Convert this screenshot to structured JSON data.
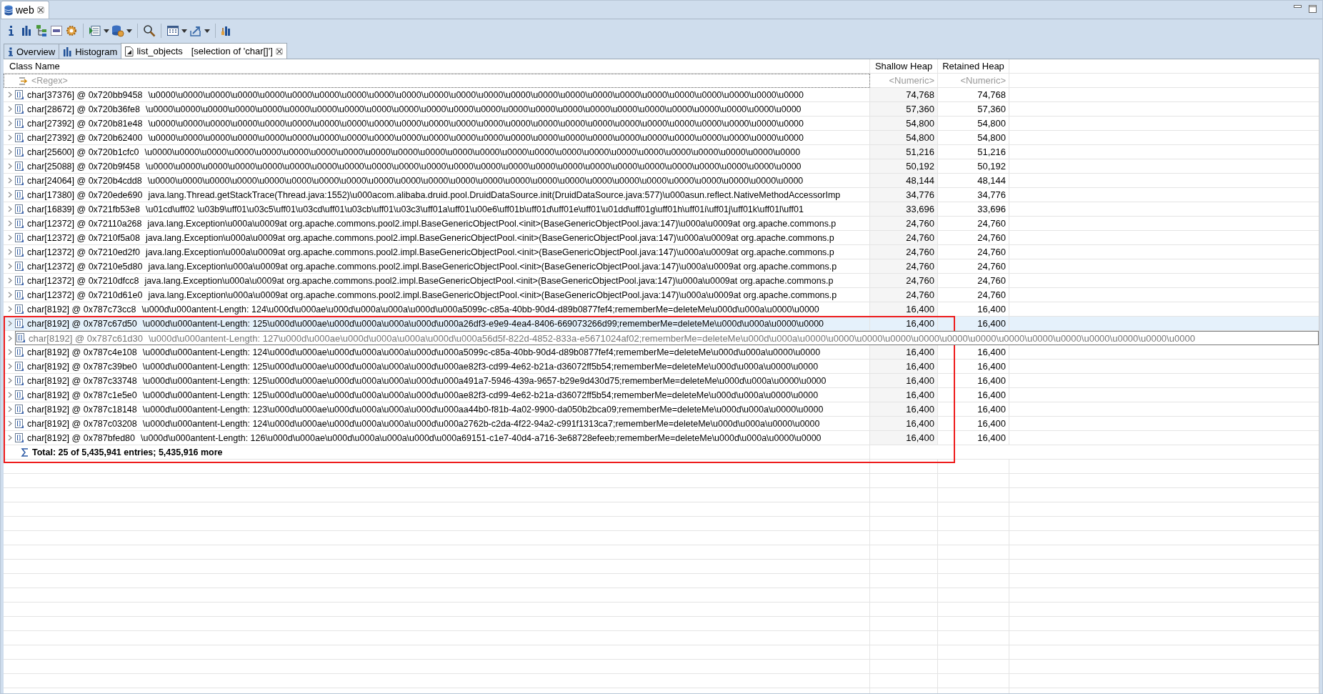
{
  "window": {
    "title": "web"
  },
  "tabs": [
    {
      "kind": "overview",
      "label": "Overview",
      "selected": false
    },
    {
      "kind": "histogram",
      "label": "Histogram",
      "selected": false
    },
    {
      "kind": "list",
      "label": "list_objects",
      "detail": "[selection of 'char[]']",
      "selected": true
    }
  ],
  "table": {
    "columns": [
      {
        "title": "Class Name",
        "filter": "<Regex>"
      },
      {
        "title": "Shallow Heap",
        "filter": "<Numeric>"
      },
      {
        "title": "Retained Heap",
        "filter": "<Numeric>"
      }
    ],
    "rows": [
      {
        "name": "char[37376] @ 0x720bb9458",
        "value": "\\u0000\\u0000\\u0000\\u0000\\u0000\\u0000\\u0000\\u0000\\u0000\\u0000\\u0000\\u0000\\u0000\\u0000\\u0000\\u0000\\u0000\\u0000\\u0000\\u0000\\u0000\\u0000\\u0000\\u0000",
        "shallow": "74,768",
        "retained": "74,768",
        "selected": false,
        "hovered": false,
        "highlighted": false
      },
      {
        "name": "char[28672] @ 0x720b36fe8",
        "value": "\\u0000\\u0000\\u0000\\u0000\\u0000\\u0000\\u0000\\u0000\\u0000\\u0000\\u0000\\u0000\\u0000\\u0000\\u0000\\u0000\\u0000\\u0000\\u0000\\u0000\\u0000\\u0000\\u0000\\u0000",
        "shallow": "57,360",
        "retained": "57,360",
        "selected": false,
        "hovered": false,
        "highlighted": false
      },
      {
        "name": "char[27392] @ 0x720b81e48",
        "value": "\\u0000\\u0000\\u0000\\u0000\\u0000\\u0000\\u0000\\u0000\\u0000\\u0000\\u0000\\u0000\\u0000\\u0000\\u0000\\u0000\\u0000\\u0000\\u0000\\u0000\\u0000\\u0000\\u0000\\u0000",
        "shallow": "54,800",
        "retained": "54,800",
        "selected": false,
        "hovered": false,
        "highlighted": false
      },
      {
        "name": "char[27392] @ 0x720b62400",
        "value": "\\u0000\\u0000\\u0000\\u0000\\u0000\\u0000\\u0000\\u0000\\u0000\\u0000\\u0000\\u0000\\u0000\\u0000\\u0000\\u0000\\u0000\\u0000\\u0000\\u0000\\u0000\\u0000\\u0000\\u0000",
        "shallow": "54,800",
        "retained": "54,800",
        "selected": false,
        "hovered": false,
        "highlighted": false
      },
      {
        "name": "char[25600] @ 0x720b1cfc0",
        "value": "\\u0000\\u0000\\u0000\\u0000\\u0000\\u0000\\u0000\\u0000\\u0000\\u0000\\u0000\\u0000\\u0000\\u0000\\u0000\\u0000\\u0000\\u0000\\u0000\\u0000\\u0000\\u0000\\u0000\\u0000",
        "shallow": "51,216",
        "retained": "51,216",
        "selected": false,
        "hovered": false,
        "highlighted": false
      },
      {
        "name": "char[25088] @ 0x720b9f458",
        "value": "\\u0000\\u0000\\u0000\\u0000\\u0000\\u0000\\u0000\\u0000\\u0000\\u0000\\u0000\\u0000\\u0000\\u0000\\u0000\\u0000\\u0000\\u0000\\u0000\\u0000\\u0000\\u0000\\u0000\\u0000",
        "shallow": "50,192",
        "retained": "50,192",
        "selected": false,
        "hovered": false,
        "highlighted": false
      },
      {
        "name": "char[24064] @ 0x720b4cdd8",
        "value": "\\u0000\\u0000\\u0000\\u0000\\u0000\\u0000\\u0000\\u0000\\u0000\\u0000\\u0000\\u0000\\u0000\\u0000\\u0000\\u0000\\u0000\\u0000\\u0000\\u0000\\u0000\\u0000\\u0000\\u0000",
        "shallow": "48,144",
        "retained": "48,144",
        "selected": false,
        "hovered": false,
        "highlighted": false
      },
      {
        "name": "char[17380] @ 0x720ede690",
        "value": "java.lang.Thread.getStackTrace(Thread.java:1552)\\u000acom.alibaba.druid.pool.DruidDataSource.init(DruidDataSource.java:577)\\u000asun.reflect.NativeMethodAccessorImp",
        "shallow": "34,776",
        "retained": "34,776",
        "selected": false,
        "hovered": false,
        "highlighted": false
      },
      {
        "name": "char[16839] @ 0x721fb53e8",
        "value": "\\u01cd\\uff02 \\u03b9\\uff01\\u03c5\\uff01\\u03cd\\uff01\\u03cb\\uff01\\u03c3\\uff01a\\uff01\\u00e6\\uff01b\\uff01d\\uff01e\\uff01\\u01dd\\uff01g\\uff01h\\uff01i\\uff01j\\uff01k\\uff01l\\uff01",
        "shallow": "33,696",
        "retained": "33,696",
        "selected": false,
        "hovered": false,
        "highlighted": false
      },
      {
        "name": "char[12372] @ 0x72110a268",
        "value": "java.lang.Exception\\u000a\\u0009at org.apache.commons.pool2.impl.BaseGenericObjectPool.<init>(BaseGenericObjectPool.java:147)\\u000a\\u0009at org.apache.commons.p",
        "shallow": "24,760",
        "retained": "24,760",
        "selected": false,
        "hovered": false,
        "highlighted": false
      },
      {
        "name": "char[12372] @ 0x7210f5a08",
        "value": "java.lang.Exception\\u000a\\u0009at org.apache.commons.pool2.impl.BaseGenericObjectPool.<init>(BaseGenericObjectPool.java:147)\\u000a\\u0009at org.apache.commons.p",
        "shallow": "24,760",
        "retained": "24,760",
        "selected": false,
        "hovered": false,
        "highlighted": false
      },
      {
        "name": "char[12372] @ 0x7210ed2f0",
        "value": "java.lang.Exception\\u000a\\u0009at org.apache.commons.pool2.impl.BaseGenericObjectPool.<init>(BaseGenericObjectPool.java:147)\\u000a\\u0009at org.apache.commons.p",
        "shallow": "24,760",
        "retained": "24,760",
        "selected": false,
        "hovered": false,
        "highlighted": false
      },
      {
        "name": "char[12372] @ 0x7210e5d80",
        "value": "java.lang.Exception\\u000a\\u0009at org.apache.commons.pool2.impl.BaseGenericObjectPool.<init>(BaseGenericObjectPool.java:147)\\u000a\\u0009at org.apache.commons.p",
        "shallow": "24,760",
        "retained": "24,760",
        "selected": false,
        "hovered": false,
        "highlighted": false
      },
      {
        "name": "char[12372] @ 0x7210dfcc8",
        "value": "java.lang.Exception\\u000a\\u0009at org.apache.commons.pool2.impl.BaseGenericObjectPool.<init>(BaseGenericObjectPool.java:147)\\u000a\\u0009at org.apache.commons.p",
        "shallow": "24,760",
        "retained": "24,760",
        "selected": false,
        "hovered": false,
        "highlighted": false
      },
      {
        "name": "char[12372] @ 0x7210d61e0",
        "value": "java.lang.Exception\\u000a\\u0009at org.apache.commons.pool2.impl.BaseGenericObjectPool.<init>(BaseGenericObjectPool.java:147)\\u000a\\u0009at org.apache.commons.p",
        "shallow": "24,760",
        "retained": "24,760",
        "selected": false,
        "hovered": false,
        "highlighted": false
      },
      {
        "name": "char[8192] @ 0x787c73cc8",
        "value": "\\u000d\\u000antent-Length: 124\\u000d\\u000ae\\u000d\\u000a\\u000a\\u000d\\u000a5099c-c85a-40bb-90d4-d89b0877fef4;rememberMe=deleteMe\\u000d\\u000a\\u0000\\u0000",
        "shallow": "16,400",
        "retained": "16,400",
        "selected": false,
        "hovered": false,
        "highlighted": false
      },
      {
        "name": "char[8192] @ 0x787c67d50",
        "value": "\\u000d\\u000antent-Length: 125\\u000d\\u000ae\\u000d\\u000a\\u000a\\u000d\\u000a26df3-e9e9-4ea4-8406-669073266d99;rememberMe=deleteMe\\u000d\\u000a\\u0000\\u0000",
        "shallow": "16,400",
        "retained": "16,400",
        "selected": true,
        "hovered": false,
        "highlighted": true
      },
      {
        "name": "char[8192] @ 0x787c61d30",
        "value": "\\u000d\\u000antent-Length: 127\\u000d\\u000ae\\u000d\\u000a\\u000a\\u000d\\u000a56d5f-822d-4852-833a-e5671024af02;rememberMe=deleteMe\\u000d\\u000a\\u0000\\u0000\\u0000\\u0000\\u0000\\u0000\\u0000\\u0000\\u0000\\u0000\\u0000\\u0000\\u0000\\u0000",
        "selected": false,
        "hovered": true,
        "highlighted": true
      },
      {
        "name": "char[8192] @ 0x787c4e108",
        "value": "\\u000d\\u000antent-Length: 124\\u000d\\u000ae\\u000d\\u000a\\u000a\\u000d\\u000a5099c-c85a-40bb-90d4-d89b0877fef4;rememberMe=deleteMe\\u000d\\u000a\\u0000\\u0000",
        "shallow": "16,400",
        "retained": "16,400",
        "selected": false,
        "hovered": false,
        "highlighted": true
      },
      {
        "name": "char[8192] @ 0x787c39be0",
        "value": "\\u000d\\u000antent-Length: 125\\u000d\\u000ae\\u000d\\u000a\\u000a\\u000d\\u000ae82f3-cd99-4e62-b21a-d36072ff5b54;rememberMe=deleteMe\\u000d\\u000a\\u0000\\u0000",
        "shallow": "16,400",
        "retained": "16,400",
        "selected": false,
        "hovered": false,
        "highlighted": true
      },
      {
        "name": "char[8192] @ 0x787c33748",
        "value": "\\u000d\\u000antent-Length: 125\\u000d\\u000ae\\u000d\\u000a\\u000a\\u000d\\u000a491a7-5946-439a-9657-b29e9d430d75;rememberMe=deleteMe\\u000d\\u000a\\u0000\\u0000",
        "shallow": "16,400",
        "retained": "16,400",
        "selected": false,
        "hovered": false,
        "highlighted": true
      },
      {
        "name": "char[8192] @ 0x787c1e5e0",
        "value": "\\u000d\\u000antent-Length: 125\\u000d\\u000ae\\u000d\\u000a\\u000a\\u000d\\u000ae82f3-cd99-4e62-b21a-d36072ff5b54;rememberMe=deleteMe\\u000d\\u000a\\u0000\\u0000",
        "shallow": "16,400",
        "retained": "16,400",
        "selected": false,
        "hovered": false,
        "highlighted": true
      },
      {
        "name": "char[8192] @ 0x787c18148",
        "value": "\\u000d\\u000antent-Length: 123\\u000d\\u000ae\\u000d\\u000a\\u000a\\u000d\\u000aa44b0-f81b-4a02-9900-da050b2bca09;rememberMe=deleteMe\\u000d\\u000a\\u0000\\u0000",
        "shallow": "16,400",
        "retained": "16,400",
        "selected": false,
        "hovered": false,
        "highlighted": true
      },
      {
        "name": "char[8192] @ 0x787c03208",
        "value": "\\u000d\\u000antent-Length: 124\\u000d\\u000ae\\u000d\\u000a\\u000a\\u000d\\u000a2762b-c2da-4f22-94a2-c991f1313ca7;rememberMe=deleteMe\\u000d\\u000a\\u0000\\u0000",
        "shallow": "16,400",
        "retained": "16,400",
        "selected": false,
        "hovered": false,
        "highlighted": true
      },
      {
        "name": "char[8192] @ 0x787bfed80",
        "value": "\\u000d\\u000antent-Length: 126\\u000d\\u000ae\\u000d\\u000a\\u000a\\u000d\\u000a69151-c1e7-40d4-a716-3e68728efeeb;rememberMe=deleteMe\\u000d\\u000a\\u0000\\u0000",
        "shallow": "16,400",
        "retained": "16,400",
        "selected": false,
        "hovered": false,
        "highlighted": true
      }
    ],
    "total": "Total: 25 of 5,435,941 entries; 5,435,916 more"
  },
  "annotation": {
    "kind": "highlight-box"
  }
}
